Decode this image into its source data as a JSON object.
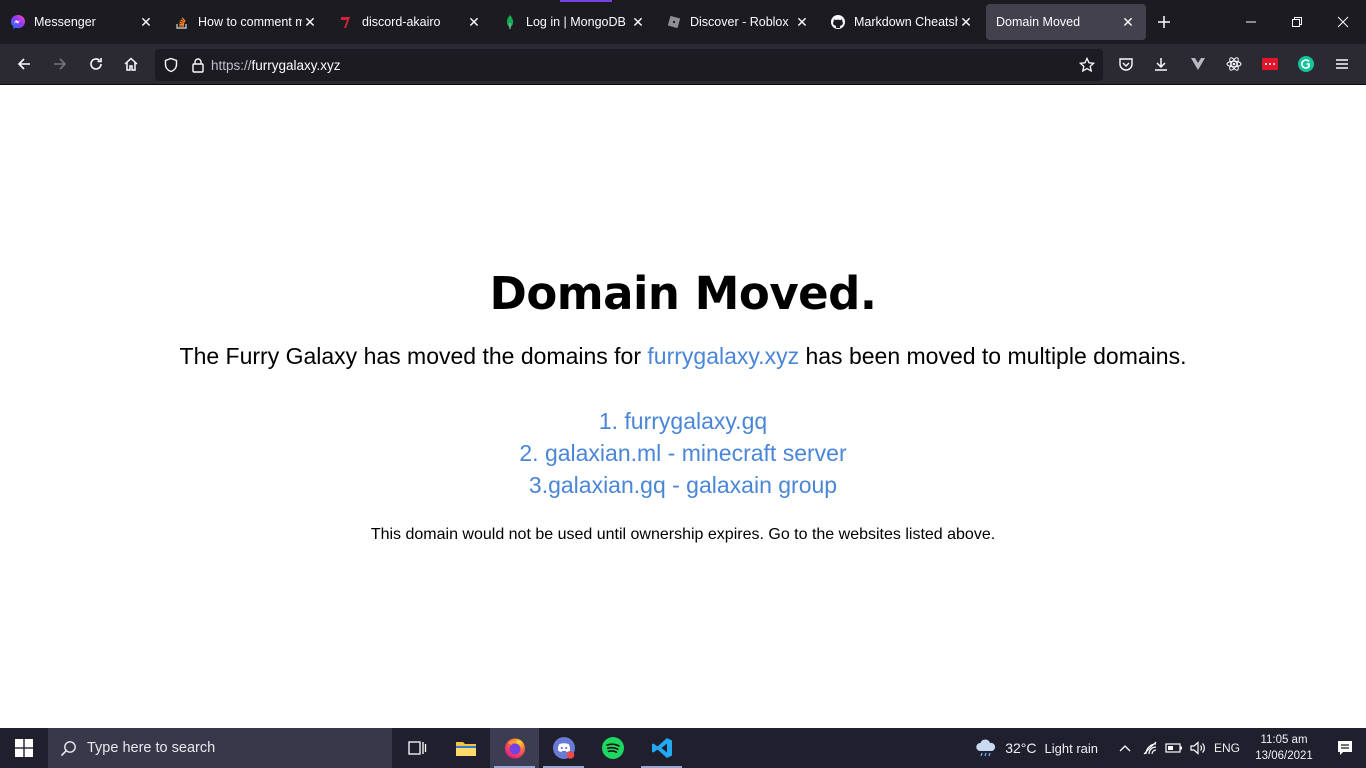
{
  "browser": {
    "tabs": [
      {
        "title": "Messenger",
        "icon": "messenger-icon"
      },
      {
        "title": "How to comment m",
        "icon": "stackoverflow-icon"
      },
      {
        "title": "discord-akairo",
        "icon": "akairo-icon"
      },
      {
        "title": "Log in | MongoDB",
        "icon": "mongodb-leaf-icon"
      },
      {
        "title": "Discover - Roblox",
        "icon": "roblox-icon"
      },
      {
        "title": "Markdown Cheatshe",
        "icon": "github-icon"
      },
      {
        "title": "Domain Moved",
        "icon": "none"
      }
    ],
    "url_protocol": "https://",
    "url_host": "furrygalaxy.xyz"
  },
  "page": {
    "heading": "Domain Moved.",
    "lead_before": "The Furry Galaxy has moved the domains for ",
    "lead_link": "furrygalaxy.xyz",
    "lead_after": " has been moved to multiple domains.",
    "links": [
      "1. furrygalaxy.gq",
      "2. galaxian.ml - minecraft server",
      "3.galaxian.gq - galaxain group"
    ],
    "note": "This domain would not be used until ownership expires. Go to the websites listed above."
  },
  "taskbar": {
    "search_placeholder": "Type here to search",
    "weather_temp": "32°C",
    "weather_desc": "Light rain",
    "language": "ENG",
    "time": "11:05 am",
    "date": "13/06/2021"
  },
  "colors": {
    "link": "#4a86d8",
    "tabbar_bg": "#1c1b22",
    "navbar_bg": "#2b2a33",
    "taskbar_bg": "#201f2e"
  }
}
